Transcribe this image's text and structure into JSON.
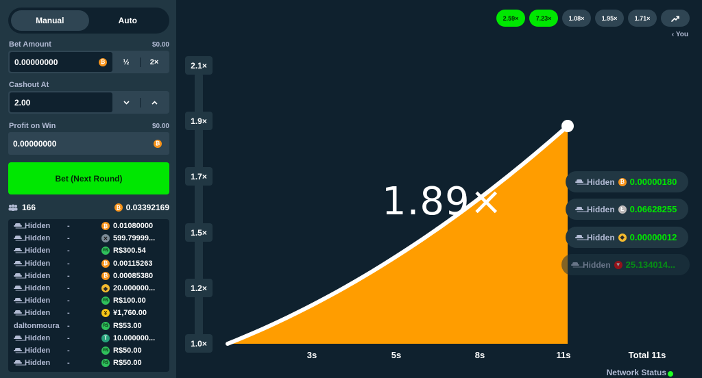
{
  "sidebar": {
    "mode_tabs": [
      "Manual",
      "Auto"
    ],
    "bet_amount": {
      "label": "Bet Amount",
      "usd": "$0.00",
      "value": "0.00000000",
      "half": "½",
      "double": "2×"
    },
    "cashout": {
      "label": "Cashout At",
      "value": "2.00"
    },
    "profit": {
      "label": "Profit on Win",
      "usd": "$0.00",
      "value": "0.00000000"
    },
    "bet_button": "Bet (Next Round)",
    "player_count": "166",
    "total_bet": "0.03392169",
    "bets": [
      {
        "user": "Hidden",
        "hidden": true,
        "payout": "-",
        "coin": "btc",
        "amount": "0.01080000"
      },
      {
        "user": "Hidden",
        "hidden": true,
        "payout": "-",
        "coin": "xrp",
        "amount": "599.79999..."
      },
      {
        "user": "Hidden",
        "hidden": true,
        "payout": "-",
        "coin": "brl",
        "amount": "R$300.54"
      },
      {
        "user": "Hidden",
        "hidden": true,
        "payout": "-",
        "coin": "btc",
        "amount": "0.00115263"
      },
      {
        "user": "Hidden",
        "hidden": true,
        "payout": "-",
        "coin": "btc",
        "amount": "0.00085380"
      },
      {
        "user": "Hidden",
        "hidden": true,
        "payout": "-",
        "coin": "bnb",
        "amount": "20.000000..."
      },
      {
        "user": "Hidden",
        "hidden": true,
        "payout": "-",
        "coin": "brl",
        "amount": "R$100.00"
      },
      {
        "user": "Hidden",
        "hidden": true,
        "payout": "-",
        "coin": "jpy",
        "amount": "¥1,760.00"
      },
      {
        "user": "daltonmoura",
        "hidden": false,
        "payout": "-",
        "coin": "brl",
        "amount": "R$53.00"
      },
      {
        "user": "Hidden",
        "hidden": true,
        "payout": "-",
        "coin": "usdt",
        "amount": "10.000000..."
      },
      {
        "user": "Hidden",
        "hidden": true,
        "payout": "-",
        "coin": "brl",
        "amount": "R$50.00"
      },
      {
        "user": "Hidden",
        "hidden": true,
        "payout": "-",
        "coin": "brl",
        "amount": "R$50.00"
      }
    ]
  },
  "history": [
    "2.59×",
    "7.23×",
    "1.08×",
    "1.95×",
    "1.71×"
  ],
  "history_green": [
    true,
    true,
    false,
    false,
    false
  ],
  "you_label": "‹ You",
  "current_multiplier": "1.89×",
  "y_ticks": [
    "2.1×",
    "1.9×",
    "1.7×",
    "1.5×",
    "1.2×",
    "1.0×"
  ],
  "x_ticks": [
    "3s",
    "5s",
    "8s",
    "11s"
  ],
  "x_total": "Total 11s",
  "cashouts": [
    {
      "user": "Hidden",
      "coin": "btc",
      "amount": "0.00000180"
    },
    {
      "user": "Hidden",
      "coin": "ltc",
      "amount": "0.06628255"
    },
    {
      "user": "Hidden",
      "coin": "bnb",
      "amount": "0.00000012"
    },
    {
      "user": "Hidden",
      "coin": "trx",
      "amount": "25.134014..."
    }
  ],
  "network_status": "Network Status",
  "colors": {
    "accent_green": "#00e701",
    "curve_fill": "#ff9d00",
    "background": "#0f212e",
    "panel": "#213743"
  }
}
